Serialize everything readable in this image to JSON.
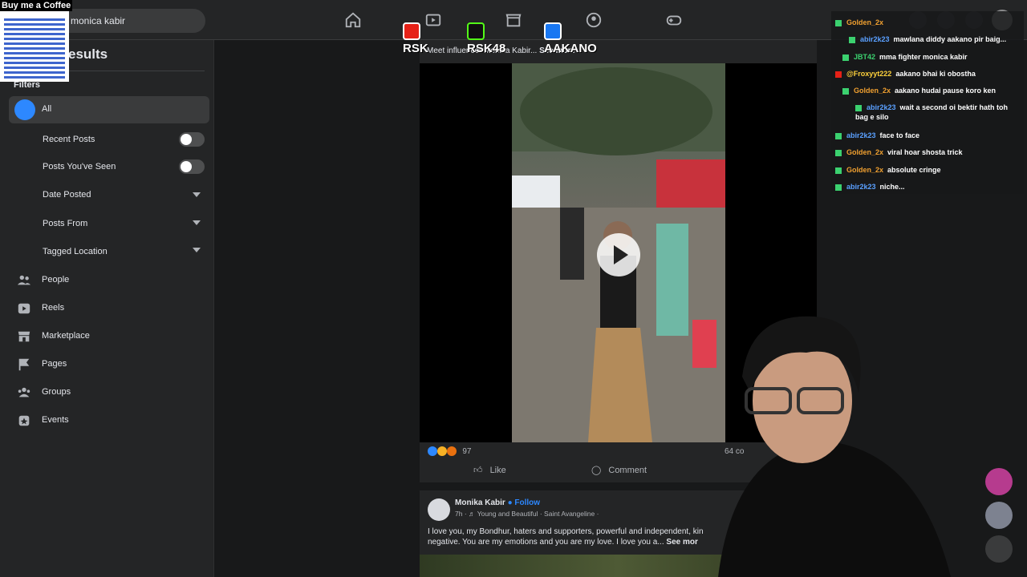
{
  "topbar": {
    "search_value": "monica kabir",
    "nav_icons": [
      "home-icon",
      "video-icon",
      "marketplace-icon",
      "groups-icon",
      "gaming-icon"
    ],
    "right_icons": [
      "menu-grid-icon",
      "messenger-icon",
      "bell-icon",
      "profile-avatar"
    ]
  },
  "overlay": {
    "coffee_label": "Buy me a Coffee",
    "socials": [
      {
        "icon": "youtube-icon",
        "label": "RSK",
        "color": "#e62117"
      },
      {
        "icon": "kick-icon",
        "label": "RSK48",
        "color": "#53fc18"
      },
      {
        "icon": "facebook-icon",
        "label": "AAKANO",
        "color": "#1877f2"
      }
    ]
  },
  "sidebar": {
    "title": "esults",
    "filters_label": "Filters",
    "all_label": "All",
    "toggles": [
      {
        "label": "Recent Posts"
      },
      {
        "label": "Posts You've Seen"
      }
    ],
    "dropdowns": [
      {
        "label": "Date Posted"
      },
      {
        "label": "Posts From"
      },
      {
        "label": "Tagged Location"
      }
    ],
    "categories": [
      {
        "label": "People",
        "icon": "people-icon"
      },
      {
        "label": "Reels",
        "icon": "reels-icon"
      },
      {
        "label": "Marketplace",
        "icon": "marketplace-icon"
      },
      {
        "label": "Pages",
        "icon": "flag-icon"
      },
      {
        "label": "Groups",
        "icon": "groups-icon"
      },
      {
        "label": "Events",
        "icon": "events-icon"
      }
    ]
  },
  "post1": {
    "caption": "Meet influencer Monika Kabir...",
    "see_more": "See more",
    "reaction_count": "97",
    "comments": "64 co",
    "like_label": "Like",
    "comment_label": "Comment"
  },
  "post2": {
    "name": "Monika Kabir",
    "follow": "Follow",
    "meta": "7h · ♬ Young and Beautiful · Saint Avangeline ·",
    "text": "I love you, my Bondhur, haters and supporters, powerful and independent, kin negative. You are my emotions and you are my love. I love you a...",
    "see_more": "See mor"
  },
  "chat": [
    {
      "user": "Golden_2x",
      "msg": "",
      "color": "#f0a030"
    },
    {
      "user": "abir2k23",
      "msg": "mawlana diddy aakano pir baig...",
      "color": "#5aa0ff"
    },
    {
      "user": "JBT42",
      "msg": "mma fighter monica kabir",
      "color": "#3bd16f"
    },
    {
      "user": "@Froxyyt222",
      "msg": "aakano bhai ki obostha",
      "color": "#ffd23c"
    },
    {
      "user": "Golden_2x",
      "msg": "aakano hudai pause koro ken",
      "color": "#f0a030"
    },
    {
      "user": "abir2k23",
      "msg": "wait a second oi bektir hath toh bag e silo",
      "color": "#5aa0ff"
    },
    {
      "user": "abir2k23",
      "msg": "face to face",
      "color": "#5aa0ff"
    },
    {
      "user": "Golden_2x",
      "msg": "viral hoar shosta trick",
      "color": "#f0a030"
    },
    {
      "user": "Golden_2x",
      "msg": "absolute cringe",
      "color": "#f0a030"
    },
    {
      "user": "abir2k23",
      "msg": "niche...",
      "color": "#5aa0ff"
    }
  ]
}
